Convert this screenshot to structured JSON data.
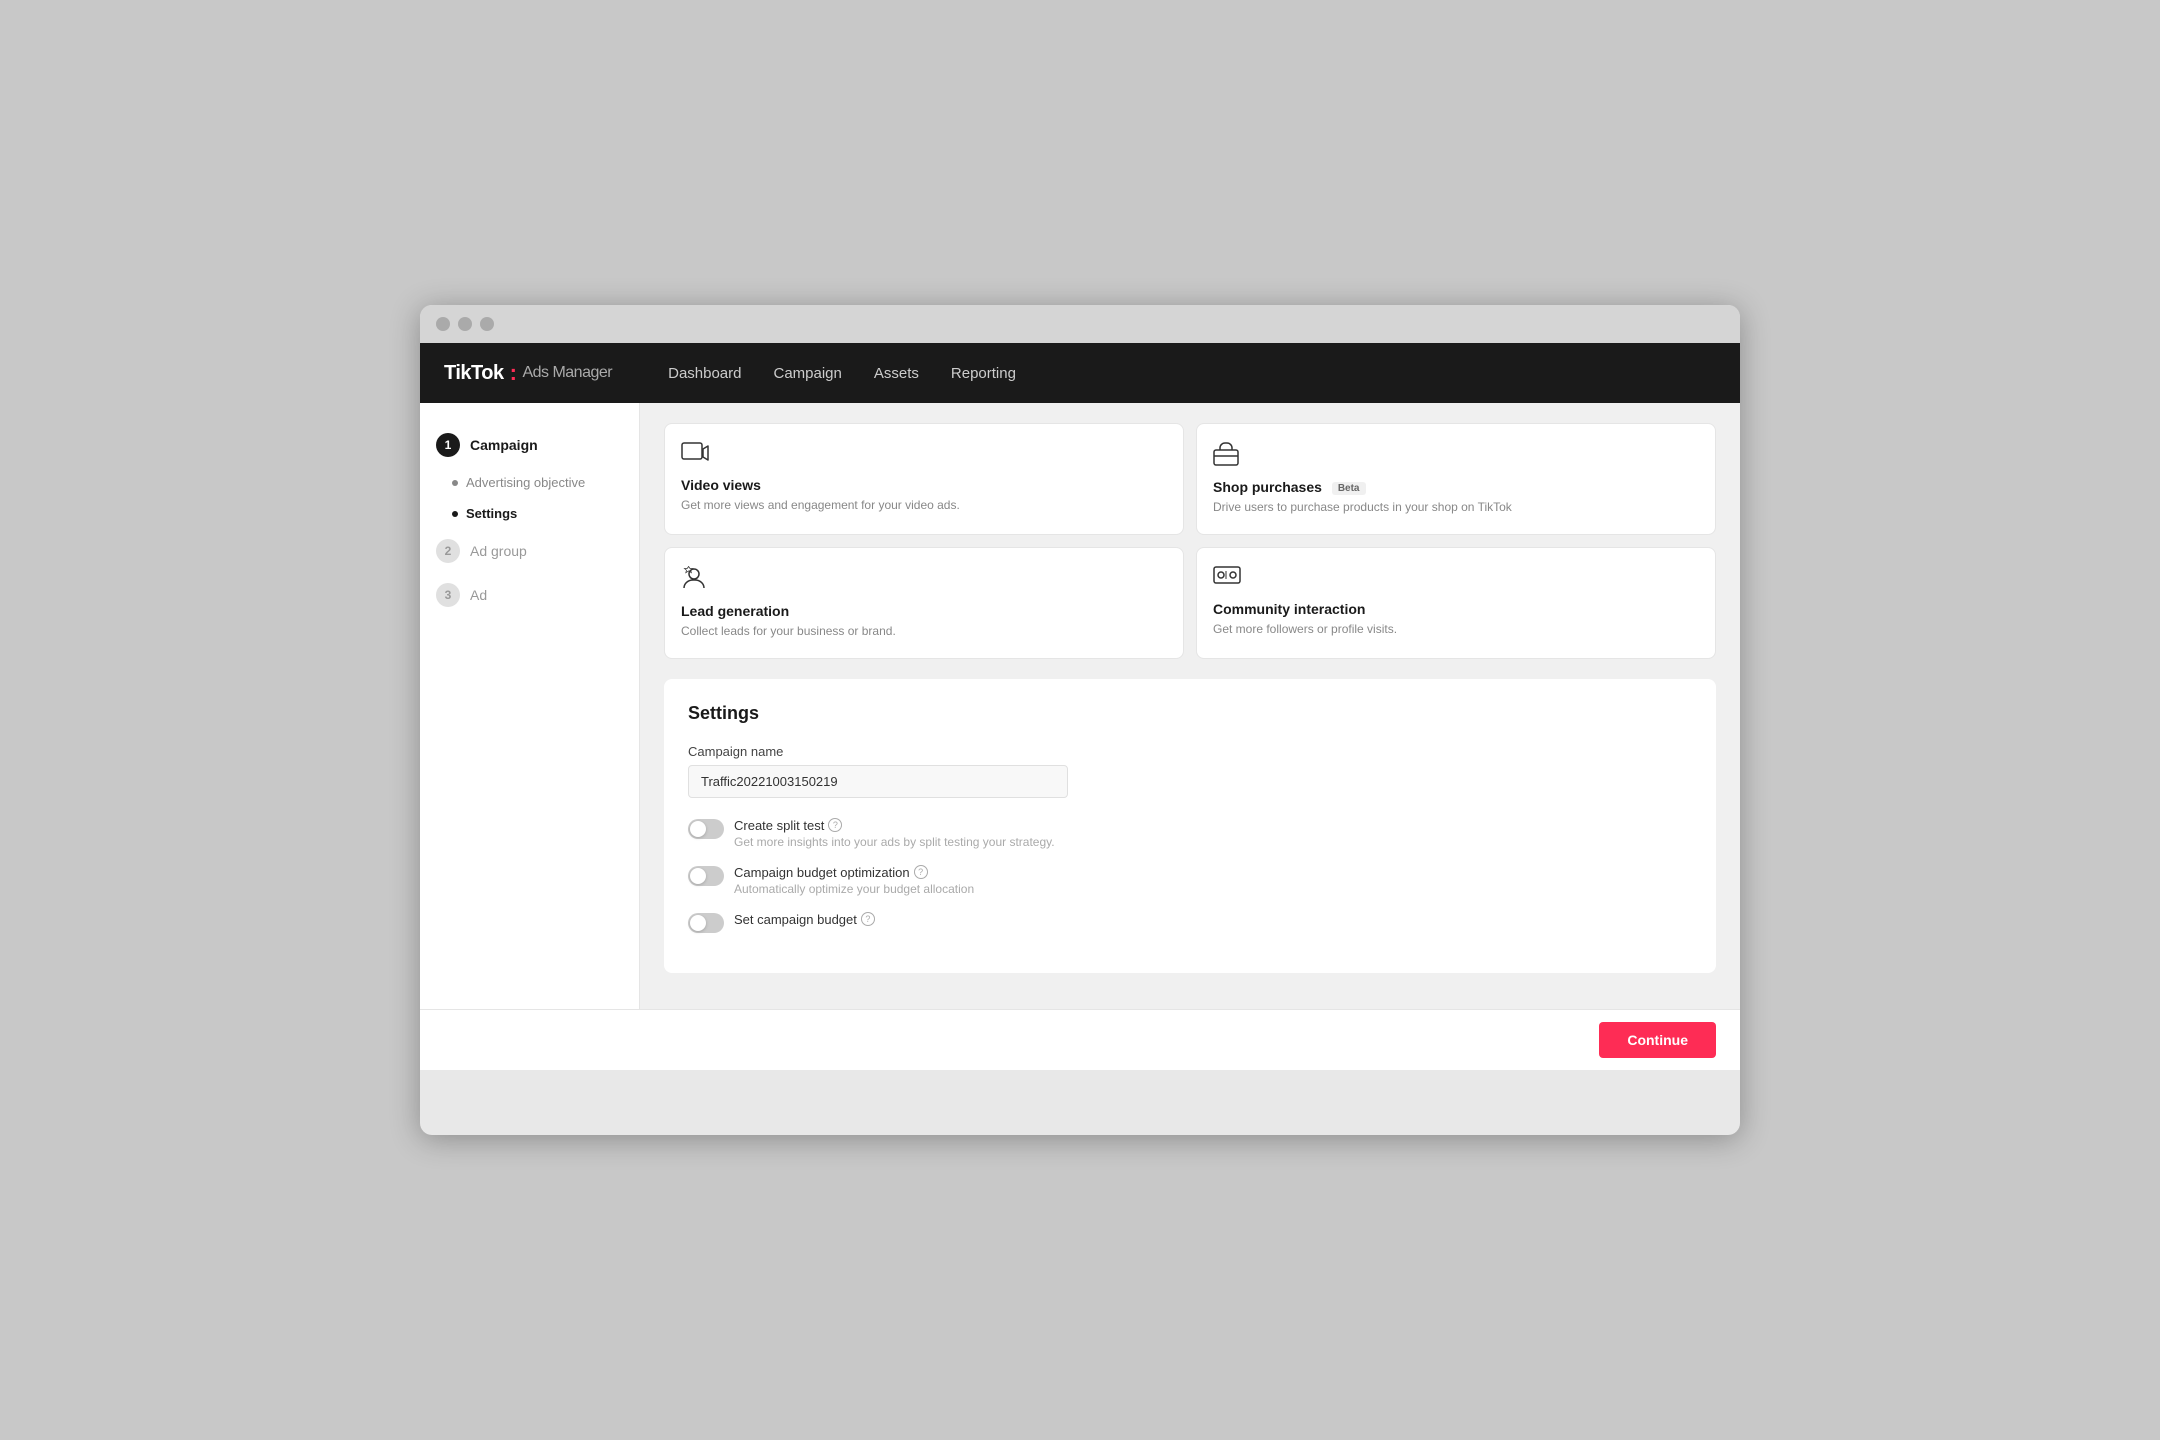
{
  "browser": {
    "dots": [
      "dot1",
      "dot2",
      "dot3"
    ]
  },
  "topnav": {
    "logo_tiktok": "TikTok",
    "logo_separator": ":",
    "logo_ads": "Ads Manager",
    "items": [
      {
        "label": "Dashboard",
        "id": "dashboard"
      },
      {
        "label": "Campaign",
        "id": "campaign"
      },
      {
        "label": "Assets",
        "id": "assets"
      },
      {
        "label": "Reporting",
        "id": "reporting"
      }
    ]
  },
  "sidebar": {
    "steps": [
      {
        "number": "1",
        "label": "Campaign",
        "active": true,
        "sub_items": [
          {
            "label": "Advertising objective",
            "active": false
          },
          {
            "label": "Settings",
            "active": true
          }
        ]
      },
      {
        "number": "2",
        "label": "Ad group",
        "active": false,
        "sub_items": []
      },
      {
        "number": "3",
        "label": "Ad",
        "active": false,
        "sub_items": []
      }
    ]
  },
  "objectives": {
    "cards": [
      {
        "id": "video-views",
        "title": "Video views",
        "description": "Get more views and engagement for your video ads.",
        "icon": "video"
      },
      {
        "id": "shop-purchases",
        "title": "Shop purchases",
        "description": "Drive users to purchase products in your shop on TikTok",
        "icon": "shop",
        "badge": "Beta"
      },
      {
        "id": "lead-generation",
        "title": "Lead generation",
        "description": "Collect leads for your business or brand.",
        "icon": "lead"
      },
      {
        "id": "community-interaction",
        "title": "Community interaction",
        "description": "Get more followers or profile visits.",
        "icon": "community"
      }
    ]
  },
  "settings": {
    "title": "Settings",
    "campaign_name_label": "Campaign name",
    "campaign_name_value": "Traffic20221003150219",
    "toggles": [
      {
        "id": "split-test",
        "label": "Create split test",
        "sub": "Get more insights into your ads by split testing your strategy.",
        "enabled": false
      },
      {
        "id": "budget-optimization",
        "label": "Campaign budget optimization",
        "sub": "Automatically optimize your budget allocation",
        "enabled": false
      },
      {
        "id": "campaign-budget",
        "label": "Set campaign budget",
        "sub": "",
        "enabled": false
      }
    ]
  },
  "footer": {
    "continue_label": "Continue"
  }
}
